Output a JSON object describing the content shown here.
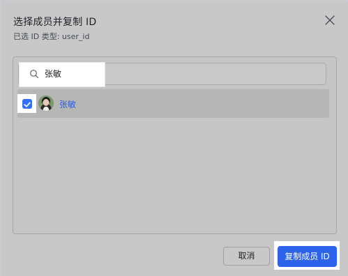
{
  "dialog": {
    "title": "选择成员并复制 ID",
    "subtitle": "已选 ID 类型: user_id"
  },
  "search": {
    "value": "张敏",
    "icon": "search-icon"
  },
  "members": [
    {
      "name": "张敏",
      "selected": true,
      "avatar": "avatar"
    }
  ],
  "buttons": {
    "cancel_label": "取消",
    "copy_label": "复制成员 ID"
  },
  "colors": {
    "accent": "#3370ff",
    "primary_button": "#2d63ea",
    "link_text": "#2e5fd6"
  }
}
